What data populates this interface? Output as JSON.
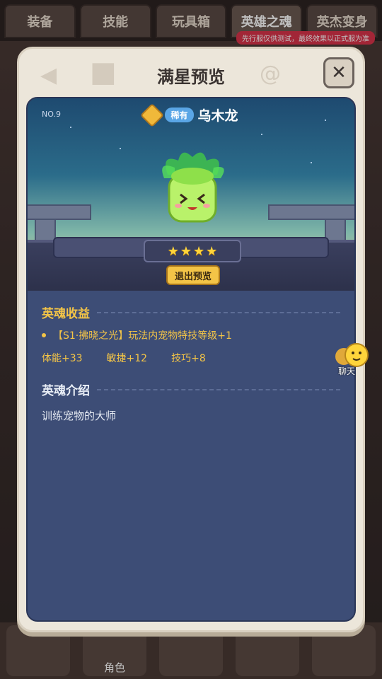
{
  "top_tabs": [
    "装备",
    "技能",
    "玩具箱",
    "英雄之魂",
    "英杰变身"
  ],
  "test_banner": "先行服仅供测试，最终效果以正式服为准",
  "bottom_nav": {
    "item_label": "角色"
  },
  "modal": {
    "title": "满星预览",
    "close_icon": "close-icon",
    "hero": {
      "number": "NO.9",
      "rarity": "稀有",
      "name": "乌木龙",
      "stars": 4,
      "exit_preview_label": "退出预览"
    },
    "benefits": {
      "title": "英魂收益",
      "skill_line": "【S1·拂晓之光】玩法内宠物特技等级+1",
      "stats": [
        "体能+33",
        "敏捷+12",
        "技巧+8"
      ]
    },
    "intro": {
      "title": "英魂介绍",
      "text": "训练宠物的大师"
    }
  },
  "chat": {
    "label": "聊天"
  },
  "colors": {
    "accent_gold": "#f3c447",
    "panel_blue": "#3d4d76",
    "rarity_blue": "#5aa6e6"
  }
}
